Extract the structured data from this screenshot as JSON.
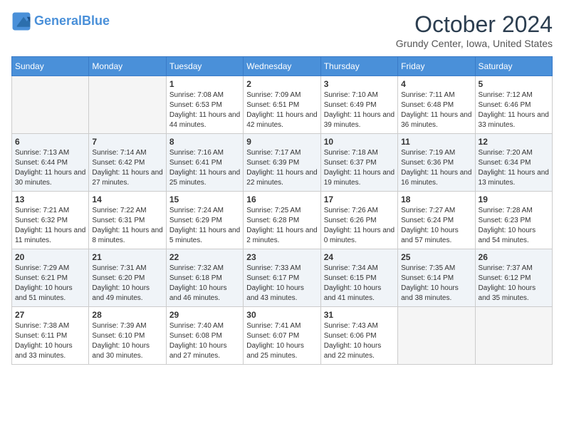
{
  "header": {
    "logo_line1": "General",
    "logo_line2": "Blue",
    "month": "October 2024",
    "location": "Grundy Center, Iowa, United States"
  },
  "days_of_week": [
    "Sunday",
    "Monday",
    "Tuesday",
    "Wednesday",
    "Thursday",
    "Friday",
    "Saturday"
  ],
  "weeks": [
    [
      {
        "day": "",
        "detail": ""
      },
      {
        "day": "",
        "detail": ""
      },
      {
        "day": "1",
        "detail": "Sunrise: 7:08 AM\nSunset: 6:53 PM\nDaylight: 11 hours and 44 minutes."
      },
      {
        "day": "2",
        "detail": "Sunrise: 7:09 AM\nSunset: 6:51 PM\nDaylight: 11 hours and 42 minutes."
      },
      {
        "day": "3",
        "detail": "Sunrise: 7:10 AM\nSunset: 6:49 PM\nDaylight: 11 hours and 39 minutes."
      },
      {
        "day": "4",
        "detail": "Sunrise: 7:11 AM\nSunset: 6:48 PM\nDaylight: 11 hours and 36 minutes."
      },
      {
        "day": "5",
        "detail": "Sunrise: 7:12 AM\nSunset: 6:46 PM\nDaylight: 11 hours and 33 minutes."
      }
    ],
    [
      {
        "day": "6",
        "detail": "Sunrise: 7:13 AM\nSunset: 6:44 PM\nDaylight: 11 hours and 30 minutes."
      },
      {
        "day": "7",
        "detail": "Sunrise: 7:14 AM\nSunset: 6:42 PM\nDaylight: 11 hours and 27 minutes."
      },
      {
        "day": "8",
        "detail": "Sunrise: 7:16 AM\nSunset: 6:41 PM\nDaylight: 11 hours and 25 minutes."
      },
      {
        "day": "9",
        "detail": "Sunrise: 7:17 AM\nSunset: 6:39 PM\nDaylight: 11 hours and 22 minutes."
      },
      {
        "day": "10",
        "detail": "Sunrise: 7:18 AM\nSunset: 6:37 PM\nDaylight: 11 hours and 19 minutes."
      },
      {
        "day": "11",
        "detail": "Sunrise: 7:19 AM\nSunset: 6:36 PM\nDaylight: 11 hours and 16 minutes."
      },
      {
        "day": "12",
        "detail": "Sunrise: 7:20 AM\nSunset: 6:34 PM\nDaylight: 11 hours and 13 minutes."
      }
    ],
    [
      {
        "day": "13",
        "detail": "Sunrise: 7:21 AM\nSunset: 6:32 PM\nDaylight: 11 hours and 11 minutes."
      },
      {
        "day": "14",
        "detail": "Sunrise: 7:22 AM\nSunset: 6:31 PM\nDaylight: 11 hours and 8 minutes."
      },
      {
        "day": "15",
        "detail": "Sunrise: 7:24 AM\nSunset: 6:29 PM\nDaylight: 11 hours and 5 minutes."
      },
      {
        "day": "16",
        "detail": "Sunrise: 7:25 AM\nSunset: 6:28 PM\nDaylight: 11 hours and 2 minutes."
      },
      {
        "day": "17",
        "detail": "Sunrise: 7:26 AM\nSunset: 6:26 PM\nDaylight: 11 hours and 0 minutes."
      },
      {
        "day": "18",
        "detail": "Sunrise: 7:27 AM\nSunset: 6:24 PM\nDaylight: 10 hours and 57 minutes."
      },
      {
        "day": "19",
        "detail": "Sunrise: 7:28 AM\nSunset: 6:23 PM\nDaylight: 10 hours and 54 minutes."
      }
    ],
    [
      {
        "day": "20",
        "detail": "Sunrise: 7:29 AM\nSunset: 6:21 PM\nDaylight: 10 hours and 51 minutes."
      },
      {
        "day": "21",
        "detail": "Sunrise: 7:31 AM\nSunset: 6:20 PM\nDaylight: 10 hours and 49 minutes."
      },
      {
        "day": "22",
        "detail": "Sunrise: 7:32 AM\nSunset: 6:18 PM\nDaylight: 10 hours and 46 minutes."
      },
      {
        "day": "23",
        "detail": "Sunrise: 7:33 AM\nSunset: 6:17 PM\nDaylight: 10 hours and 43 minutes."
      },
      {
        "day": "24",
        "detail": "Sunrise: 7:34 AM\nSunset: 6:15 PM\nDaylight: 10 hours and 41 minutes."
      },
      {
        "day": "25",
        "detail": "Sunrise: 7:35 AM\nSunset: 6:14 PM\nDaylight: 10 hours and 38 minutes."
      },
      {
        "day": "26",
        "detail": "Sunrise: 7:37 AM\nSunset: 6:12 PM\nDaylight: 10 hours and 35 minutes."
      }
    ],
    [
      {
        "day": "27",
        "detail": "Sunrise: 7:38 AM\nSunset: 6:11 PM\nDaylight: 10 hours and 33 minutes."
      },
      {
        "day": "28",
        "detail": "Sunrise: 7:39 AM\nSunset: 6:10 PM\nDaylight: 10 hours and 30 minutes."
      },
      {
        "day": "29",
        "detail": "Sunrise: 7:40 AM\nSunset: 6:08 PM\nDaylight: 10 hours and 27 minutes."
      },
      {
        "day": "30",
        "detail": "Sunrise: 7:41 AM\nSunset: 6:07 PM\nDaylight: 10 hours and 25 minutes."
      },
      {
        "day": "31",
        "detail": "Sunrise: 7:43 AM\nSunset: 6:06 PM\nDaylight: 10 hours and 22 minutes."
      },
      {
        "day": "",
        "detail": ""
      },
      {
        "day": "",
        "detail": ""
      }
    ]
  ]
}
